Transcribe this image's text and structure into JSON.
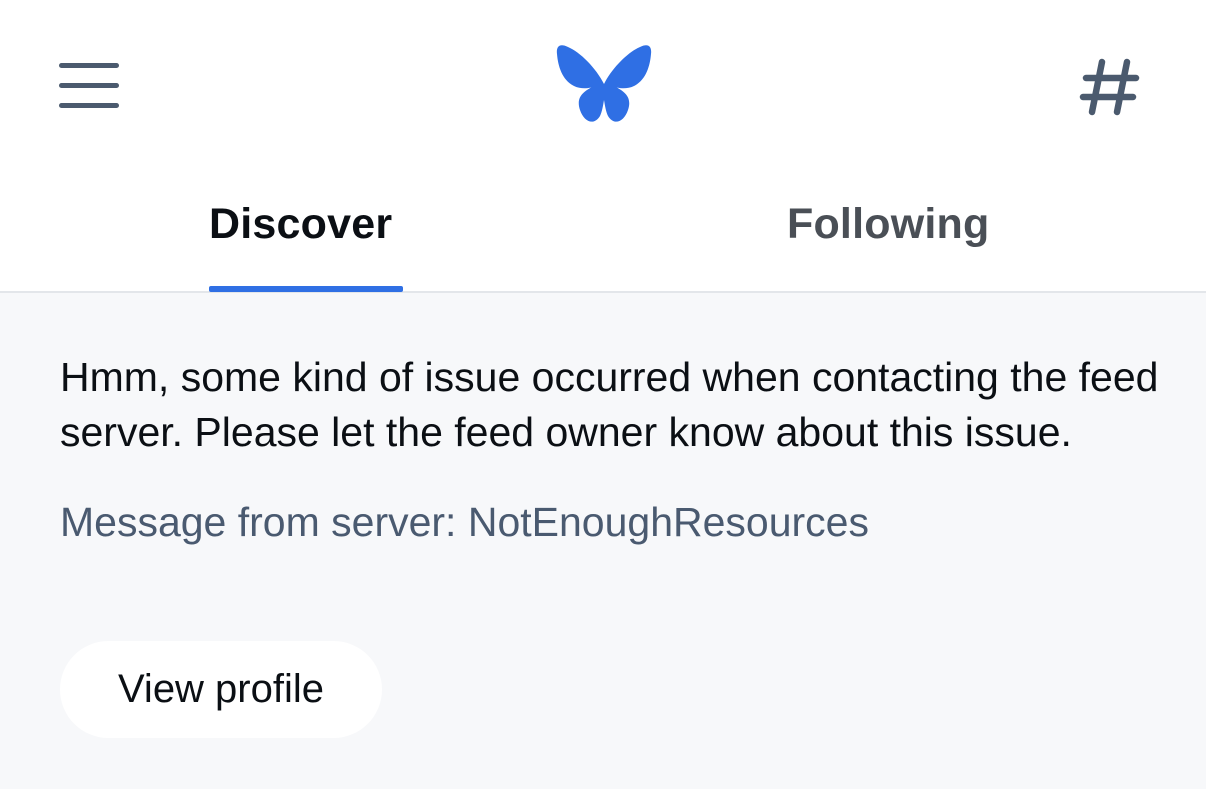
{
  "header": {
    "menu_icon": "hamburger-menu-icon",
    "logo_icon": "butterfly-logo-icon",
    "feeds_icon": "hashtag-icon",
    "brand_color": "#2f6fe4"
  },
  "tabs": [
    {
      "label": "Discover",
      "active": true
    },
    {
      "label": "Following",
      "active": false
    }
  ],
  "error": {
    "message": "Hmm, some kind of issue occurred when contacting the feed server. Please let the feed owner know about this issue.",
    "server_message": "Message from server: NotEnoughResources"
  },
  "actions": {
    "view_profile_label": "View profile"
  }
}
